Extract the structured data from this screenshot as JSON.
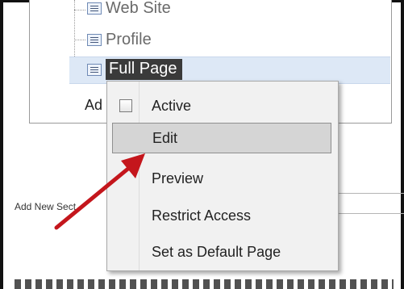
{
  "tree": {
    "items": [
      {
        "label": "Web Site"
      },
      {
        "label": "Profile"
      },
      {
        "label": "Full Page",
        "selected": true
      }
    ],
    "add_label": "Ad"
  },
  "page": {
    "add_new_section": "Add New Sect"
  },
  "context_menu": {
    "items": [
      {
        "label": "Active",
        "checkbox": true,
        "checked": false
      },
      {
        "label": "Edit",
        "hovered": true
      },
      {
        "label": "Preview"
      },
      {
        "label": "Restrict Access"
      },
      {
        "label": "Set as Default Page"
      }
    ]
  },
  "colors": {
    "arrow": "#c4161c",
    "selection_bg": "#dde8f6",
    "menu_bg": "#f1f1f1"
  }
}
